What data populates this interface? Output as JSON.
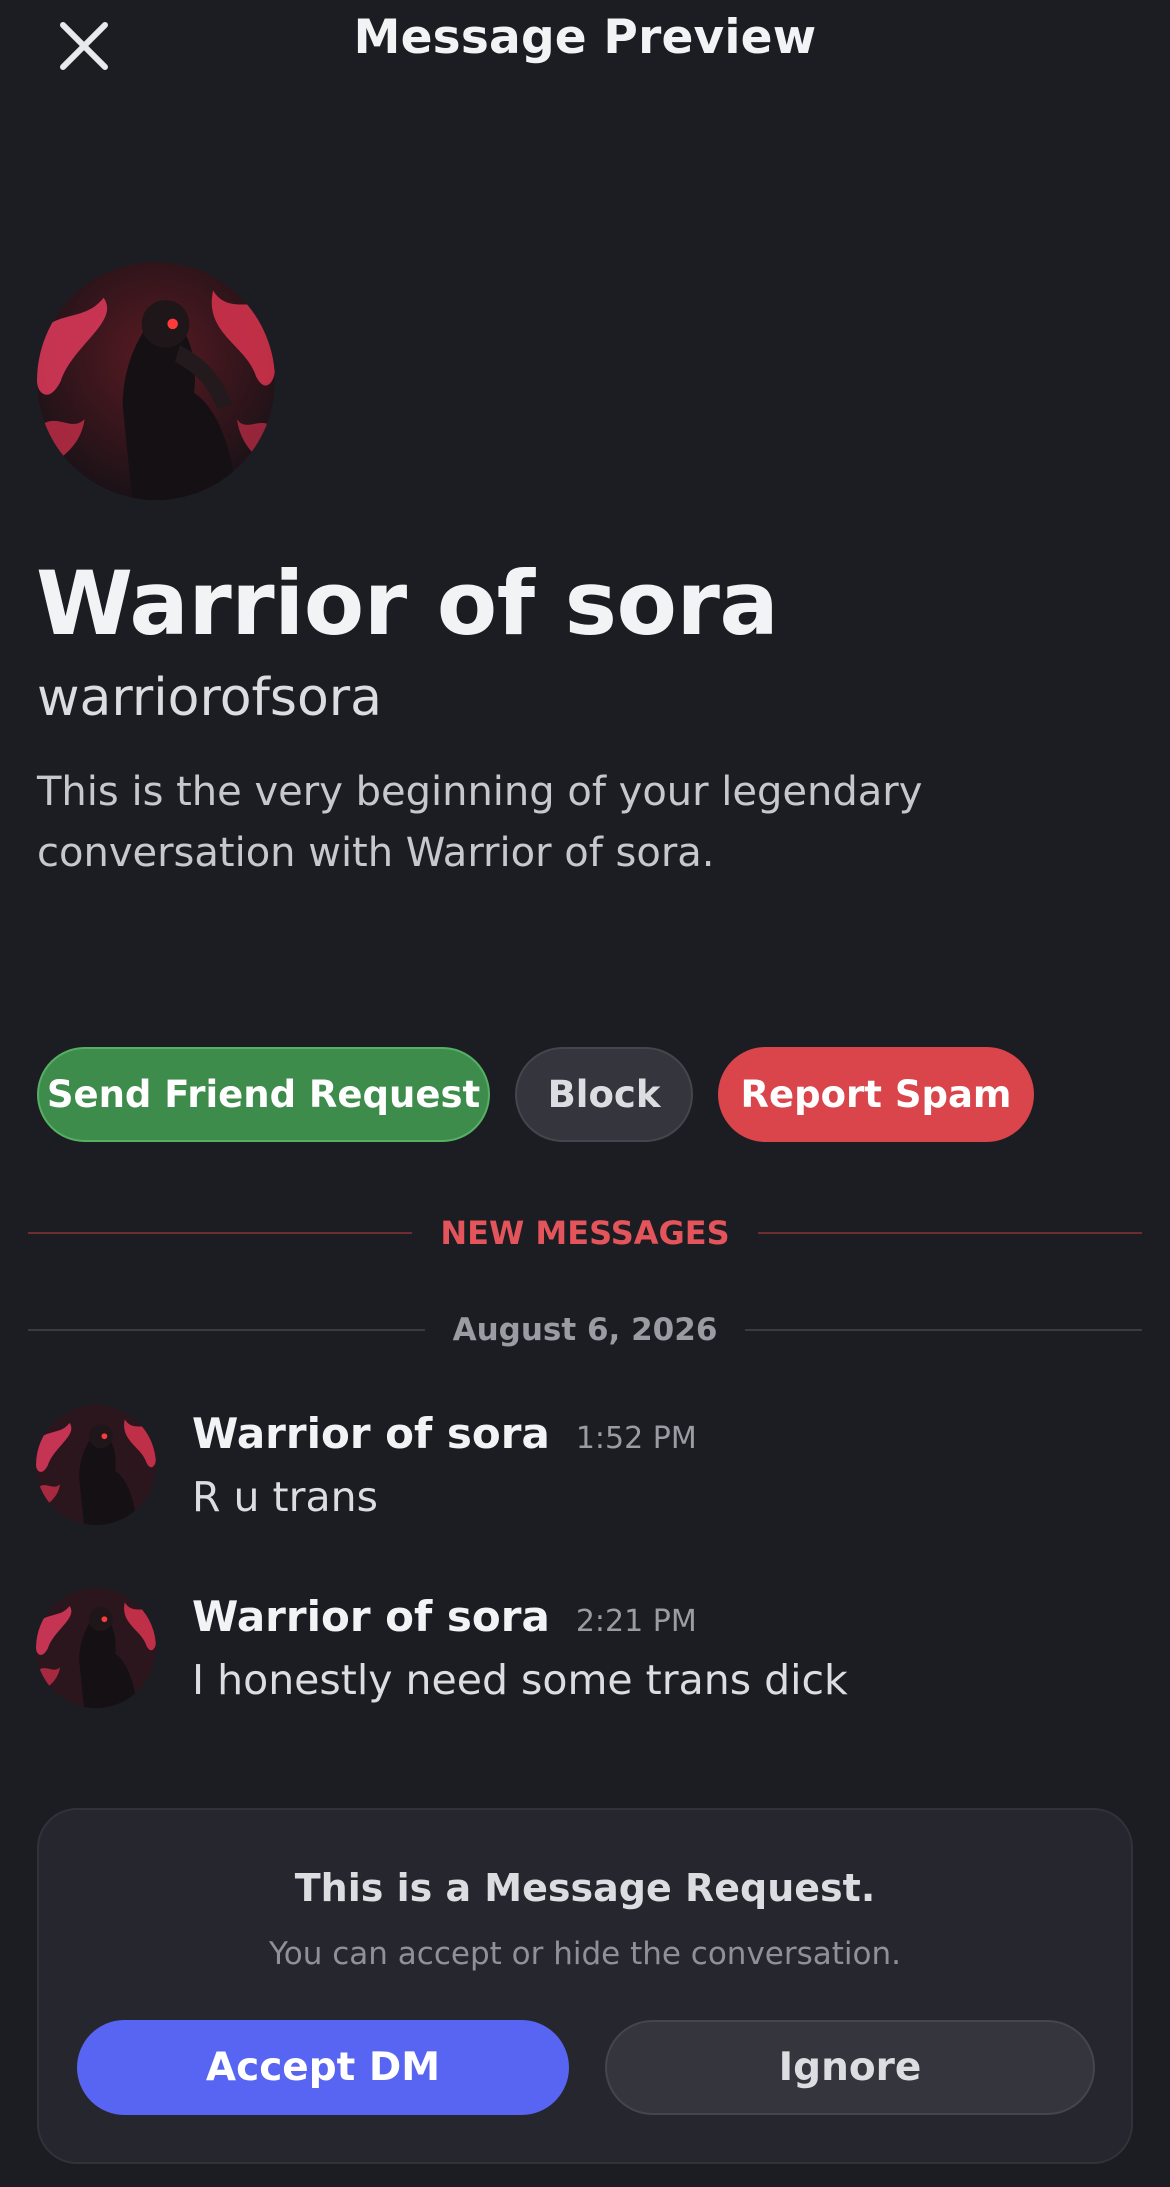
{
  "header": {
    "title": "Message Preview",
    "close_icon": "close-icon"
  },
  "profile": {
    "avatar": "avatar-image",
    "display_name": "Warrior of sora",
    "username": "warriorofsora",
    "intro": "This is the very beginning of your legendary conversation with Warrior of sora."
  },
  "actions": {
    "send_friend_request": "Send Friend Request",
    "block": "Block",
    "report_spam": "Report Spam"
  },
  "dividers": {
    "new_messages": "NEW MESSAGES",
    "date": "August 6, 2026"
  },
  "messages": [
    {
      "author": "Warrior of sora",
      "time": "1:52 PM",
      "content": "R u trans"
    },
    {
      "author": "Warrior of sora",
      "time": "2:21 PM",
      "content": "I honestly need some trans dick"
    }
  ],
  "request": {
    "title": "This is a Message Request.",
    "subtitle": "You can accept or hide the conversation.",
    "accept_label": "Accept DM",
    "ignore_label": "Ignore"
  },
  "colors": {
    "background": "#1c1d22",
    "friend_green": "#3e8c4b",
    "report_red": "#d9454a",
    "accept_blurple": "#5865f2",
    "new_messages_red": "#e3545b"
  }
}
